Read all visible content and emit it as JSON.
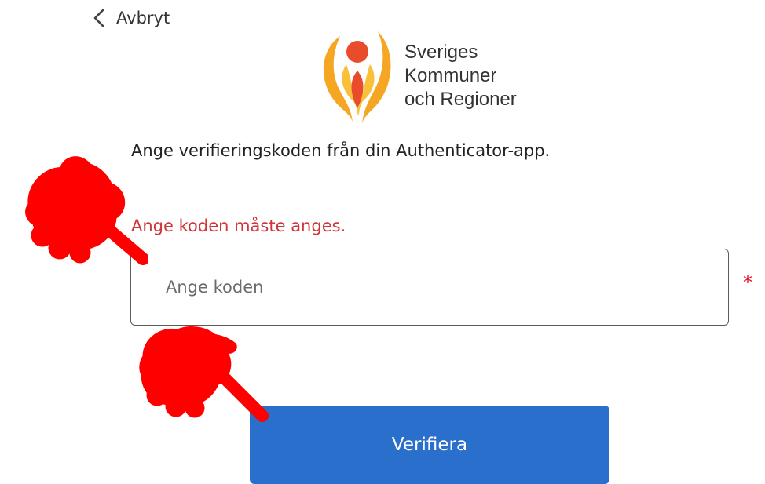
{
  "header": {
    "back_label": "Avbryt",
    "back_icon": "chevron-left-icon"
  },
  "logo": {
    "line1": "Sveriges",
    "line2": "Kommuner",
    "line3": "och Regioner",
    "icon": "skr-logo-icon"
  },
  "form": {
    "instruction": "Ange verifieringskoden från din Authenticator-app.",
    "error": "Ange koden måste anges.",
    "code_placeholder": "Ange koden",
    "code_value": "",
    "required_marker": "*",
    "verify_label": "Verifiera"
  },
  "annotations": {
    "pointer_icon": "pointing-hand-icon",
    "pointer_color": "#ff0000"
  },
  "colors": {
    "button": "#2a6fcb",
    "error": "#d13438",
    "required": "#e81123",
    "logo_orange": "#f5a623",
    "logo_red": "#e84c2b"
  }
}
